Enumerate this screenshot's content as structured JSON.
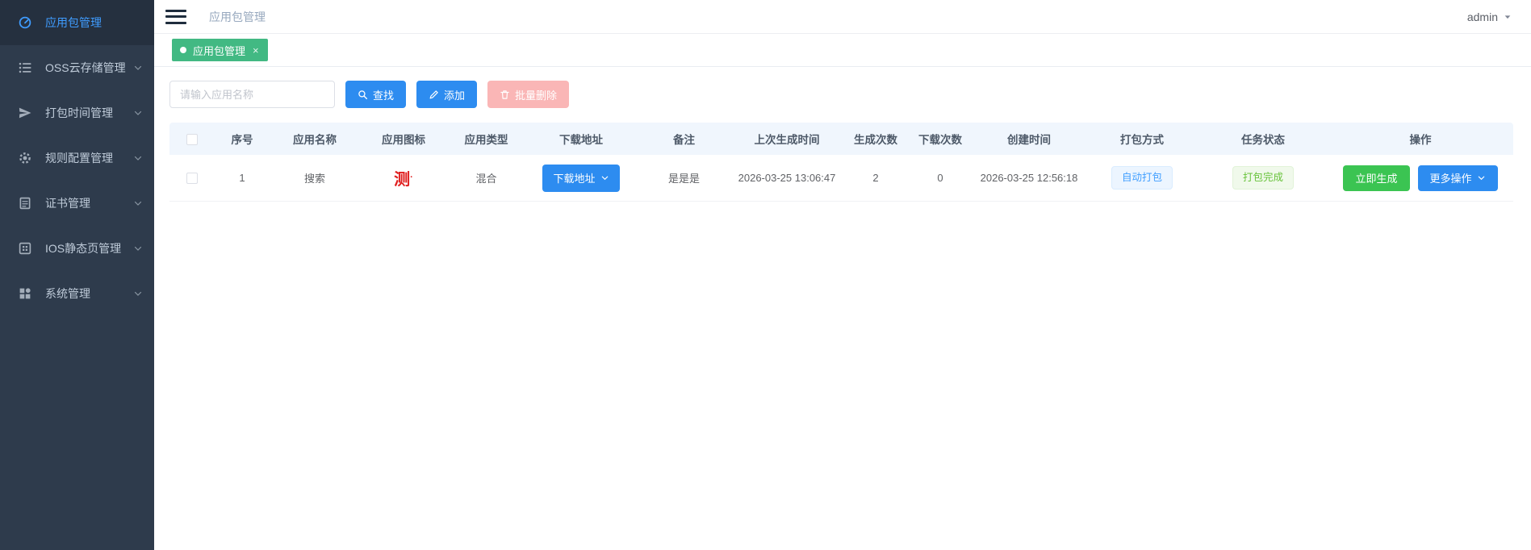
{
  "sidebar": {
    "items": [
      {
        "label": "应用包管理",
        "icon": "dashboard-icon",
        "active": true,
        "expandable": false
      },
      {
        "label": "OSS云存储管理",
        "icon": "list-icon",
        "active": false,
        "expandable": true
      },
      {
        "label": "打包时间管理",
        "icon": "send-icon",
        "active": false,
        "expandable": true
      },
      {
        "label": "规则配置管理",
        "icon": "gear-icon",
        "active": false,
        "expandable": true
      },
      {
        "label": "证书管理",
        "icon": "certificate-icon",
        "active": false,
        "expandable": true
      },
      {
        "label": "IOS静态页管理",
        "icon": "qrcode-icon",
        "active": false,
        "expandable": true
      },
      {
        "label": "系统管理",
        "icon": "grid-icon",
        "active": false,
        "expandable": true
      }
    ]
  },
  "header": {
    "breadcrumb": "应用包管理",
    "user": "admin"
  },
  "tabs": [
    {
      "label": "应用包管理",
      "active": true,
      "close_glyph": "×"
    }
  ],
  "toolbar": {
    "search_placeholder": "请输入应用名称",
    "search_value": "",
    "find_label": "查找",
    "add_label": "添加",
    "batch_delete_label": "批量删除"
  },
  "table": {
    "columns": [
      "序号",
      "应用名称",
      "应用图标",
      "应用类型",
      "下载地址",
      "备注",
      "上次生成时间",
      "生成次数",
      "下载次数",
      "创建时间",
      "打包方式",
      "任务状态",
      "操作"
    ],
    "rows": [
      {
        "index": "1",
        "app_name": "搜索",
        "app_icon_text": "测",
        "app_type": "混合",
        "download_button_label": "下载地址",
        "remark": "是是是",
        "last_generated_time": "2026-03-25 13:06:47",
        "generate_count": "2",
        "download_count": "0",
        "created_time": "2026-03-25 12:56:18",
        "package_mode": "自动打包",
        "task_status": "打包完成",
        "generate_now_label": "立即生成",
        "more_actions_label": "更多操作"
      }
    ]
  },
  "colors": {
    "sidebar_bg": "#2e3b4c",
    "sidebar_active_bg": "#25303f",
    "sidebar_active_text": "#3f9cff",
    "tab_green": "#42b983",
    "primary_blue": "#2d8cf0",
    "danger_disabled_pink": "#fab6b6",
    "success_green": "#3bc452",
    "badge_blue_text": "#409eff",
    "badge_blue_bg": "#ecf5ff",
    "badge_green_text": "#67c23a",
    "badge_green_bg": "#f0f9eb",
    "app_icon_red": "#e01f1f",
    "table_header_bg": "#f0f6fd"
  }
}
